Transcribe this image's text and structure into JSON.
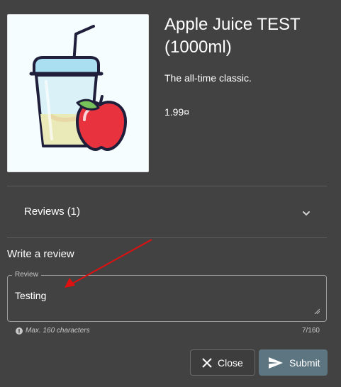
{
  "product": {
    "title": "Apple Juice TEST (1000ml)",
    "description": "The all-time classic.",
    "price": "1.99¤"
  },
  "reviews": {
    "label": "Reviews",
    "count": "(1)"
  },
  "write_review": {
    "title": "Write a review",
    "field_label": "Review",
    "value": "Testing",
    "hint": "Max. 160 characters",
    "counter": "7/160"
  },
  "buttons": {
    "close_label": "Close",
    "submit_label": "Submit"
  },
  "icons": {
    "product_image": "juice-cup-with-apple",
    "chevron": "chevron-down-icon",
    "hint": "exclamation-circle-icon",
    "close": "close-x-icon",
    "submit": "send-icon"
  },
  "colors": {
    "background": "#424242",
    "submit_button": "#5d7581",
    "annotation_arrow": "#e01010"
  }
}
